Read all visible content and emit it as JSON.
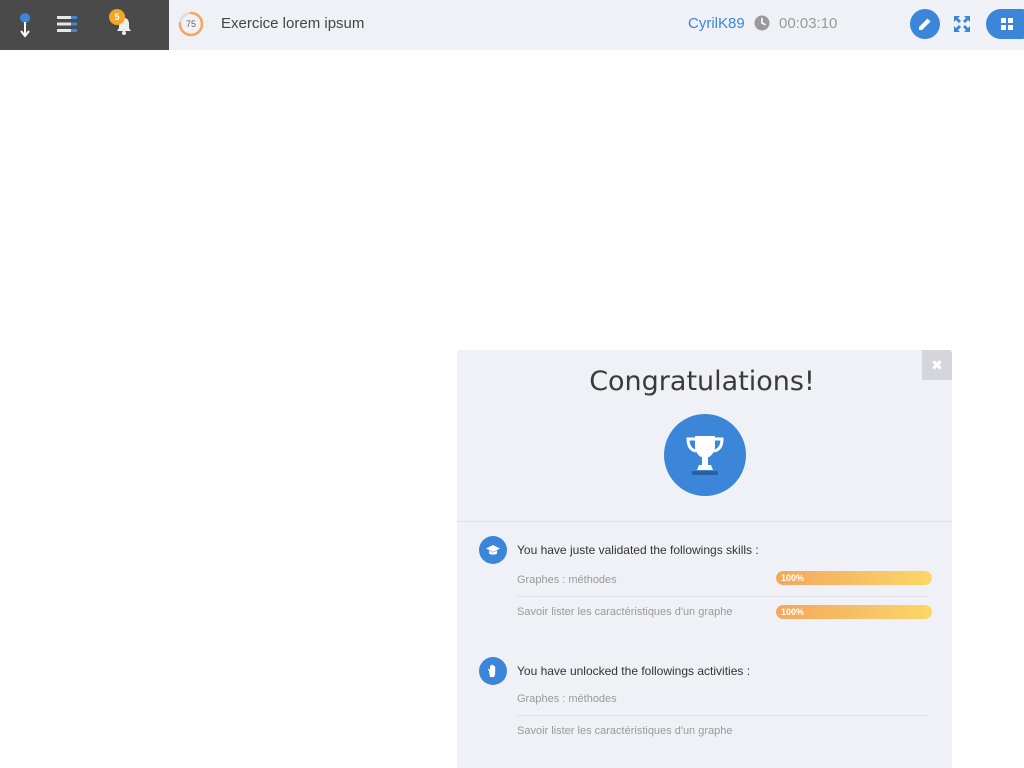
{
  "header": {
    "notification_count": "5",
    "progress_value": "75",
    "progress_fraction": 0.75,
    "exercise_title": "Exercice lorem ipsum",
    "username": "CyrilK89",
    "timer": "00:03:10",
    "icons": [
      "pin-icon",
      "menu-icon",
      "bell-icon",
      "clock-icon",
      "pencil-icon",
      "expand-icon",
      "grid-icon"
    ],
    "colors": {
      "accent": "#3b86d9",
      "badge": "#f5a623",
      "dark": "#4a4a4a",
      "bar": "#f0f1f6"
    }
  },
  "modal": {
    "close_glyph": "✖",
    "title": "Congratulations!",
    "trophy_icon": "trophy-icon",
    "skills": {
      "title": "You have juste validated the followings skills :",
      "icon": "graduation-cap-icon",
      "items": [
        {
          "label": "Graphes : méthodes",
          "progress_label": "100%",
          "progress": 1.0
        },
        {
          "label": "Savoir lister les caractéristiques d'un graphe",
          "progress_label": "100%",
          "progress": 1.0
        }
      ]
    },
    "activities": {
      "title": "You have unlocked the followings activities :",
      "icon": "hand-icon",
      "items": [
        {
          "label": "Graphes : méthodes"
        },
        {
          "label": "Savoir lister les caractéristiques d'un graphe"
        }
      ]
    }
  }
}
